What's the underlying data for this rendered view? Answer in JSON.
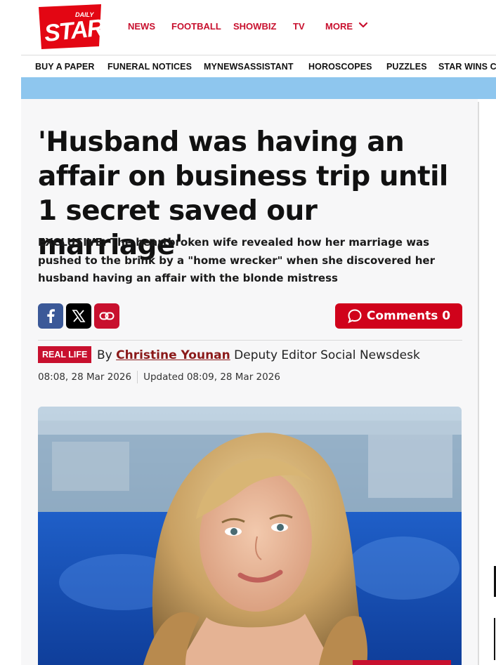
{
  "header": {
    "logo": {
      "top": "DAILY",
      "main": "STAR"
    },
    "nav": [
      {
        "label": "NEWS"
      },
      {
        "label": "FOOTBALL"
      },
      {
        "label": "SHOWBIZ"
      },
      {
        "label": "TV"
      },
      {
        "label": "MORE"
      }
    ]
  },
  "subnav": [
    {
      "label": "BUY A PAPER"
    },
    {
      "label": "FUNERAL NOTICES"
    },
    {
      "label": "MYNEWSASSISTANT"
    },
    {
      "label": "HOROSCOPES"
    },
    {
      "label": "PUZZLES"
    },
    {
      "label": "STAR WINS C"
    }
  ],
  "article": {
    "headline": "'Husband was having an affair on business trip until 1 secret saved our marriage'",
    "standfirst": "EXCLUSIVE: The heartbroken wife revealed how her marriage was pushed to the brink by a \"home wrecker\" when she discovered her husband having an affair with the blonde mistress",
    "share": {
      "facebook_icon": "facebook-icon",
      "x_icon": "x-icon",
      "link_icon": "link-icon"
    },
    "comments": {
      "label": "Comments",
      "count": "0"
    },
    "tag": "REAL LIFE",
    "byline": {
      "prefix": "By",
      "author": "Christine Younan",
      "role": "Deputy Editor Social Newsdesk"
    },
    "published": "08:08, 28 Mar 2026",
    "updated": "Updated 08:09, 28 Mar 2026"
  },
  "colors": {
    "brand_red": "#c8102e",
    "banner_blue": "#8ec6ee",
    "facebook_blue": "#3b5998"
  }
}
